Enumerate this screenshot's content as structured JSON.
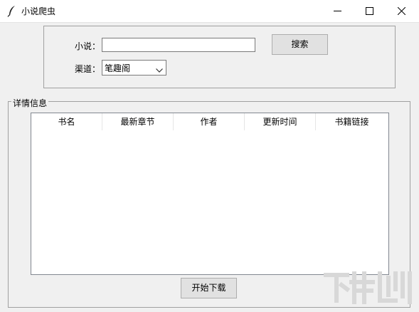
{
  "window": {
    "title": "小说爬虫"
  },
  "search": {
    "novel_label": "小说：",
    "novel_value": "",
    "channel_label": "渠道：",
    "channel_selected": "笔趣阁",
    "search_button": "搜索"
  },
  "details": {
    "group_label": "详情信息",
    "columns": [
      "书名",
      "最新章节",
      "作者",
      "更新时间",
      "书籍链接"
    ],
    "rows": []
  },
  "actions": {
    "download_button": "开始下载"
  },
  "icons": {
    "app": "feather-icon",
    "minimize": "minimize-icon",
    "maximize": "maximize-icon",
    "close": "close-icon",
    "dropdown": "chevron-down-icon"
  }
}
